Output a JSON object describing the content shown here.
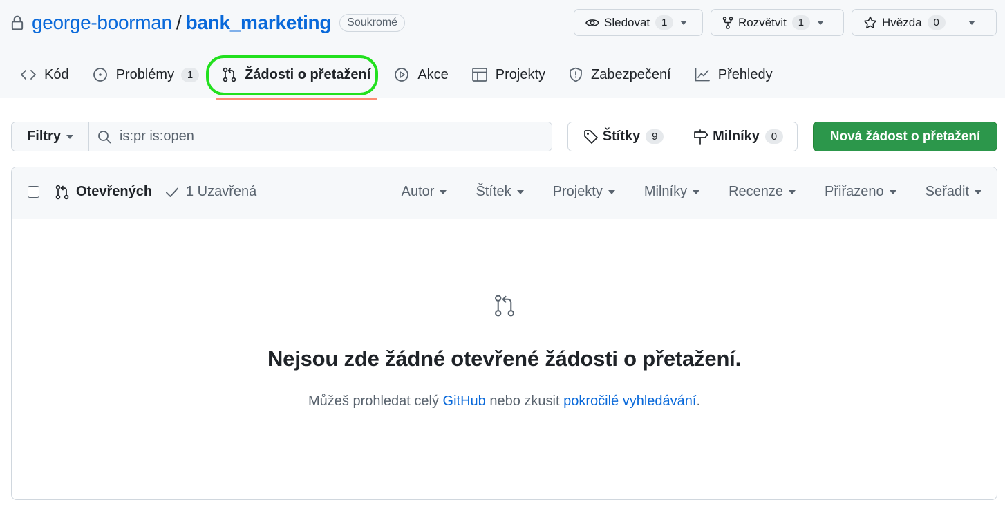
{
  "repo": {
    "owner": "george-boorman",
    "separator": "/",
    "name": "bank_marketing",
    "visibility": "Soukromé"
  },
  "actions": {
    "watch": {
      "label": "Sledovat",
      "count": "1"
    },
    "fork": {
      "label": "Rozvětvit",
      "count": "1"
    },
    "star": {
      "label": "Hvězda",
      "count": "0"
    }
  },
  "tabs": [
    {
      "label": "Kód",
      "icon": "code-icon"
    },
    {
      "label": "Problémy",
      "icon": "issue-opened-icon",
      "count": "1"
    },
    {
      "label": "Žádosti o přetažení",
      "icon": "git-pull-request-icon",
      "selected": true
    },
    {
      "label": "Akce",
      "icon": "play-icon"
    },
    {
      "label": "Projekty",
      "icon": "table-icon"
    },
    {
      "label": "Zabezpečení",
      "icon": "shield-icon"
    },
    {
      "label": "Přehledy",
      "icon": "graph-icon"
    }
  ],
  "highlight_color": "#22e01e",
  "subnav": {
    "filters_label": "Filtry",
    "search_value": "is:pr is:open",
    "labels": {
      "label": "Štítky",
      "count": "9"
    },
    "milestones": {
      "label": "Milníky",
      "count": "0"
    },
    "new_pr_label": "Nová žádost o přetažení"
  },
  "list": {
    "open_label": "Otevřených",
    "closed_label": "1 Uzavřená",
    "sort_menus": [
      "Autor",
      "Štítek",
      "Projekty",
      "Milníky",
      "Recenze",
      "Přiřazeno",
      "Seřadit"
    ]
  },
  "blankslate": {
    "title": "Nejsou zde žádné otevřené žádosti o přetažení.",
    "text_before": "Můžeš prohledat celý ",
    "link1": "GitHub",
    "text_middle": " nebo zkusit ",
    "link2": "pokročilé vyhledávání",
    "text_after": "."
  },
  "colors": {
    "link": "#0969da",
    "primary_button": "#2c974b",
    "selected_tab_underline": "#fd8c73"
  }
}
